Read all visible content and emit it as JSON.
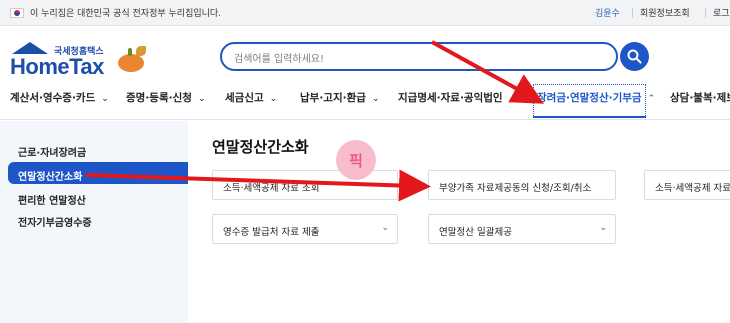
{
  "gov_bar": {
    "text": "이 누리집은 대한민국 공식 전자정부 누리집입니다.",
    "user": "김윤수",
    "links": [
      "회원정보조회",
      "로그"
    ]
  },
  "header": {
    "logo_sub": "국세청홈택스",
    "logo_main": "HomeTax",
    "search_placeholder": "검색어를 입력하세요!"
  },
  "menu": {
    "items": [
      {
        "label": "계산서·영수증·카드"
      },
      {
        "label": "증명·등록·신청"
      },
      {
        "label": "세금신고"
      },
      {
        "label": "납부·고지·환급"
      },
      {
        "label": "지급명세·자료·공익법인"
      },
      {
        "label": "장려금·연말정산·기부금",
        "active": true
      },
      {
        "label": "상담·불복·제보"
      }
    ]
  },
  "sidebar": {
    "items": [
      {
        "label": "근로·자녀장려금"
      },
      {
        "label": "연말정산간소화",
        "active": true
      },
      {
        "label": "편리한 연말정산"
      },
      {
        "label": "전자기부금영수증"
      }
    ]
  },
  "content": {
    "title": "연말정산간소화",
    "cards": [
      {
        "label": "소득·세액공제 자료 조회"
      },
      {
        "label": "부양가족 자료제공동의 신청/조회/취소"
      },
      {
        "label": "소득·세액공제 자료 수"
      },
      {
        "label": "영수증 발급처 자료 제출"
      },
      {
        "label": "연말정산 일괄제공"
      }
    ]
  },
  "stamp": {
    "text": "픽"
  },
  "colors": {
    "accent": "#1e56c8",
    "arrow": "#e3181d",
    "sidebar_bg": "#f3f6fb"
  }
}
